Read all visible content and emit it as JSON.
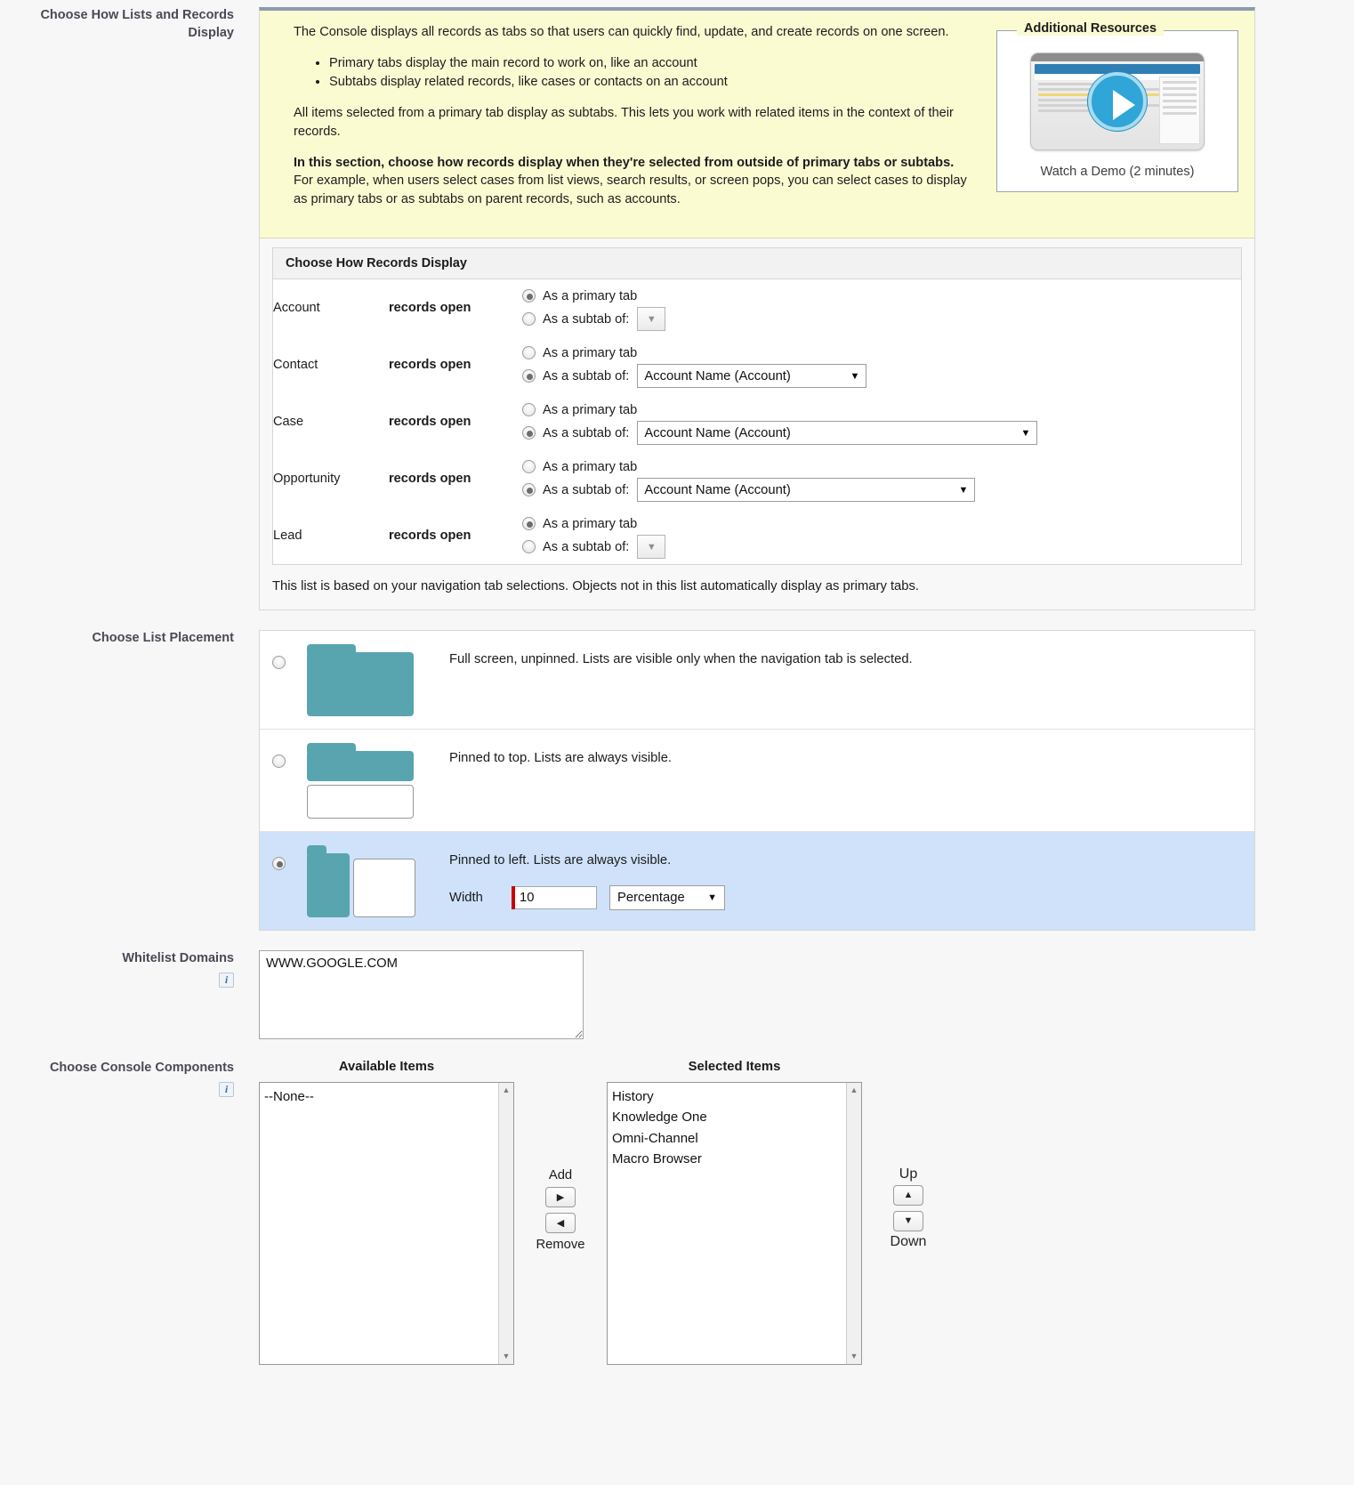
{
  "sections": {
    "lists_records_label": "Choose How Lists and Records Display",
    "list_placement_label": "Choose List Placement",
    "whitelist_label": "Whitelist Domains",
    "console_components_label": "Choose Console Components"
  },
  "help": {
    "intro": "The Console displays all records as tabs so that users can quickly find, update, and create records on one screen.",
    "bullets": [
      "Primary tabs display the main record to work on, like an account",
      "Subtabs display related records, like cases or contacts on an account"
    ],
    "para2": "All items selected from a primary tab display as subtabs. This lets you work with related items in the context of their records.",
    "para3_bold": "In this section, choose how records display when they're selected from outside of primary tabs or subtabs.",
    "para3_rest": " For example, when users select cases from list views, search results, or screen pops, you can select cases to display as primary tabs or as subtabs on parent records, such as accounts."
  },
  "resources": {
    "legend": "Additional Resources",
    "caption": "Watch a Demo (2 minutes)",
    "play_icon": "play-icon"
  },
  "records_display": {
    "header": "Choose How Records Display",
    "open_label": "records open",
    "primary_label": "As a primary tab",
    "subtab_label": "As a subtab of:",
    "note": "This list is based on your navigation tab selections. Objects not in this list automatically display as primary tabs.",
    "rows": [
      {
        "object": "Account",
        "mode": "primary",
        "subtab_value": "",
        "select_width": 32
      },
      {
        "object": "Contact",
        "mode": "subtab",
        "subtab_value": "Account Name (Account)",
        "select_width": 258
      },
      {
        "object": "Case",
        "mode": "subtab",
        "subtab_value": "Account Name (Account)",
        "select_width": 450
      },
      {
        "object": "Opportunity",
        "mode": "subtab",
        "subtab_value": "Account Name (Account)",
        "select_width": 380
      },
      {
        "object": "Lead",
        "mode": "primary",
        "subtab_value": "",
        "select_width": 32
      }
    ]
  },
  "placement": {
    "options": [
      {
        "id": "full",
        "label": "Full screen, unpinned. Lists are visible only when the navigation tab is selected.",
        "selected": false
      },
      {
        "id": "top",
        "label": "Pinned to top. Lists are always visible.",
        "selected": false
      },
      {
        "id": "left",
        "label": "Pinned to left. Lists are always visible.",
        "selected": true
      }
    ],
    "width_label": "Width",
    "width_value": "10",
    "unit_value": "Percentage",
    "folder_color": "#58a5b0"
  },
  "whitelist": {
    "value": "WWW.GOOGLE.COM",
    "info_icon": "info-icon"
  },
  "console_components": {
    "info_icon": "info-icon",
    "available_title": "Available Items",
    "selected_title": "Selected Items",
    "available_items": [
      "--None--"
    ],
    "selected_items": [
      "History",
      "Knowledge One",
      "Omni-Channel",
      "Macro Browser"
    ],
    "add_label": "Add",
    "remove_label": "Remove",
    "up_label": "Up",
    "down_label": "Down",
    "add_icon": "arrow-right-icon",
    "remove_icon": "arrow-left-icon",
    "up_icon": "arrow-up-icon",
    "down_icon": "arrow-down-icon"
  }
}
